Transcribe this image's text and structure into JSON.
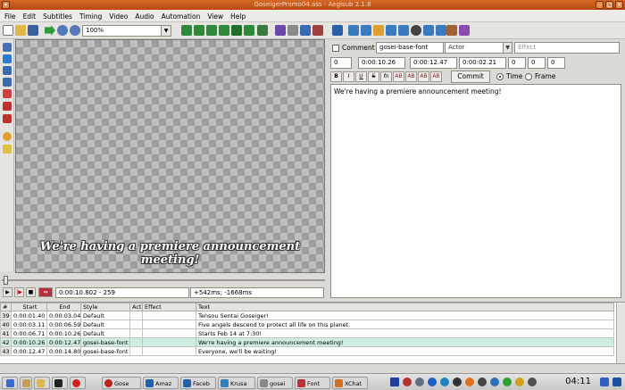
{
  "window": {
    "title": "GoseigerPromo04.ass - Aegisub 2.1.8"
  },
  "menu": [
    "File",
    "Edit",
    "Subtitles",
    "Timing",
    "Video",
    "Audio",
    "Automation",
    "View",
    "Help"
  ],
  "toolbar": {
    "zoom": "100%"
  },
  "video": {
    "subtitle": "We're having a premiere announcement meeting!"
  },
  "playback": {
    "time": "0:00:10.802 - 259",
    "offset": "+542ms; -1668ms"
  },
  "edit": {
    "comment_label": "Comment",
    "style": "gosei-base-font",
    "actor_placeholder": "Actor",
    "effect_placeholder": "Effect",
    "layer": "0",
    "start": "0:00:10.26",
    "end": "0:00:12.47",
    "duration": "0:00:02.21",
    "margin_l": "0",
    "margin_r": "0",
    "margin_v": "0",
    "format_buttons": [
      "B",
      "I",
      "U",
      "S",
      "fn",
      "AB",
      "AB",
      "AB",
      "AB"
    ],
    "commit_label": "Commit",
    "time_label": "Time",
    "frame_label": "Frame",
    "text": "We're having a premiere announcement meeting!"
  },
  "grid": {
    "headers": [
      "#",
      "Start",
      "End",
      "Style",
      "Act",
      "Effect",
      "Text"
    ],
    "rows": [
      {
        "n": "39",
        "start": "0:00:01.40",
        "end": "0:00:03.04",
        "style": "Default",
        "act": "",
        "effect": "",
        "text": "Tensou Sentai Goseiger!"
      },
      {
        "n": "40",
        "start": "0:00:03.11",
        "end": "0:00:06.59",
        "style": "Default",
        "act": "",
        "effect": "",
        "text": "Five angels descend to protect all life on this planet."
      },
      {
        "n": "41",
        "start": "0:00:06.71",
        "end": "0:00:10.26",
        "style": "Default",
        "act": "",
        "effect": "",
        "text": "Starts Feb 14 at 7:30!"
      },
      {
        "n": "42",
        "start": "0:00:10.26",
        "end": "0:00:12.47",
        "style": "gosei-base-font",
        "act": "",
        "effect": "",
        "text": "We're having a premiere announcement meeting!"
      },
      {
        "n": "43",
        "start": "0:00:12.47",
        "end": "0:00:14.80",
        "style": "gosei-base-font",
        "act": "",
        "effect": "",
        "text": "Everyone, we'll be waiting!"
      }
    ]
  },
  "taskbar": {
    "tasks": [
      "Gose",
      "Amaz",
      "Faceb",
      "Krusa",
      "gosei",
      "Font",
      "XChat"
    ],
    "clock": "04:11"
  },
  "colors": {
    "titlebar": "#c85a1a",
    "selected_row": "#cdeee0"
  }
}
